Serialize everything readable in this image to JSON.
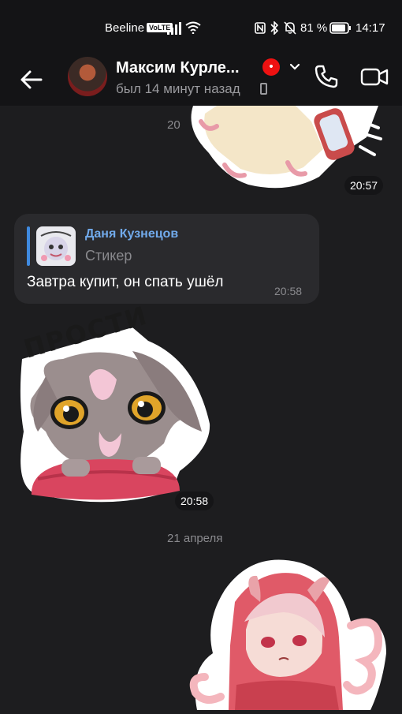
{
  "status_bar": {
    "carrier": "Beeline",
    "volte": "VoLTE",
    "battery": "81 %",
    "time": "14:17"
  },
  "header": {
    "contact_name": "Максим Курле...",
    "last_seen": "был 14 минут назад"
  },
  "messages": [
    {
      "type": "sticker",
      "time": "20:57",
      "date_fragment": "20"
    },
    {
      "type": "text",
      "reply": {
        "author": "Даня Кузнецов",
        "kind": "Стикер"
      },
      "text": "Завтра купит, он спать ушёл",
      "time": "20:58"
    },
    {
      "type": "sticker",
      "sticker_text": "ПРОСТИ",
      "time": "20:58"
    }
  ],
  "date_separator": "21 апреля",
  "colors": {
    "background": "#1d1d1f",
    "bar": "#141416",
    "bubble": "#2a2a2d",
    "accent": "#71aaeb"
  }
}
